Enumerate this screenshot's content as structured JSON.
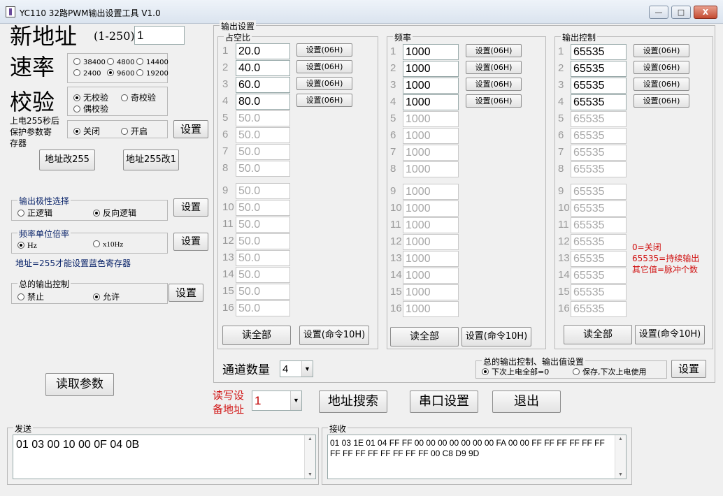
{
  "window": {
    "title": "YC110 32路PWM输出设置工具   V1.0",
    "min": "—",
    "max": "□",
    "close": "X"
  },
  "left": {
    "new_addr_label": "新地址",
    "new_addr_range": "(1-250)",
    "new_addr_value": "1",
    "rate_label": "速率",
    "rate_options": [
      "38400",
      "4800",
      "14400",
      "2400",
      "9600",
      "19200"
    ],
    "parity_label": "校验",
    "parity_options": [
      "无校验",
      "奇校验",
      "偶校验"
    ],
    "poweron_label": [
      "上电255秒后",
      "保护参数寄",
      "存器"
    ],
    "poweron_options": [
      "关闭",
      "开启"
    ],
    "set_btn": "设置",
    "addr_to255": "地址改255",
    "addr255_to1": "地址255改1",
    "polarity_caption": "输出极性选择",
    "polarity_options": [
      "正逻辑",
      "反向逻辑"
    ],
    "freq_unit_caption": "频率单位倍率",
    "freq_unit_options": [
      "Hz",
      "x10Hz"
    ],
    "blue_note": "地址=255才能设置蓝色寄存器",
    "master_caption": "总的输出控制",
    "master_options": [
      "禁止",
      "允许"
    ],
    "read_params": "读取参数"
  },
  "out": {
    "caption": "输出设置",
    "duty": {
      "caption": "占空比",
      "values": [
        "20.0",
        "40.0",
        "60.0",
        "80.0",
        "50.0",
        "50.0",
        "50.0",
        "50.0",
        "50.0",
        "50.0",
        "50.0",
        "50.0",
        "50.0",
        "50.0",
        "50.0",
        "50.0"
      ]
    },
    "freq": {
      "caption": "频率",
      "values": [
        "1000",
        "1000",
        "1000",
        "1000",
        "1000",
        "1000",
        "1000",
        "1000",
        "1000",
        "1000",
        "1000",
        "1000",
        "1000",
        "1000",
        "1000",
        "1000"
      ]
    },
    "ctrl": {
      "caption": "输出控制",
      "values": [
        "65535",
        "65535",
        "65535",
        "65535",
        "65535",
        "65535",
        "65535",
        "65535",
        "65535",
        "65535",
        "65535",
        "65535",
        "65535",
        "65535",
        "65535",
        "65535"
      ]
    },
    "row_numbers": [
      "1",
      "2",
      "3",
      "4",
      "5",
      "6",
      "7",
      "8",
      "9",
      "10",
      "11",
      "12",
      "13",
      "14",
      "15",
      "16"
    ],
    "set06": "设置(06H)",
    "read_all": "读全部",
    "set10": "设置(命令10H)",
    "note": [
      "0=关闭",
      "65535=持续输出",
      "其它值=脉冲个数"
    ],
    "channel_count_label": "通道数量",
    "channel_count_value": "4",
    "master2_caption": "总的输出控制、输出值设置",
    "master2_options": [
      "下次上电全部=0",
      "保存,下次上电使用"
    ]
  },
  "bottom": {
    "rw_label": [
      "读写设",
      "备地址"
    ],
    "rw_value": "1",
    "addr_search": "地址搜索",
    "serial_setup": "串口设置",
    "exit": "退出",
    "send_caption": "发送",
    "send_text": "01 03 00 10 00 0F 04 0B",
    "recv_caption": "接收",
    "recv_line1": "01 03 1E 01 04 FF FF 00 00 00 00 00 00 00 FA 00 00 FF FF FF FF FF FF",
    "recv_line2": "FF FF FF FF FF FF FF FF 00 C8 D9 9D"
  }
}
